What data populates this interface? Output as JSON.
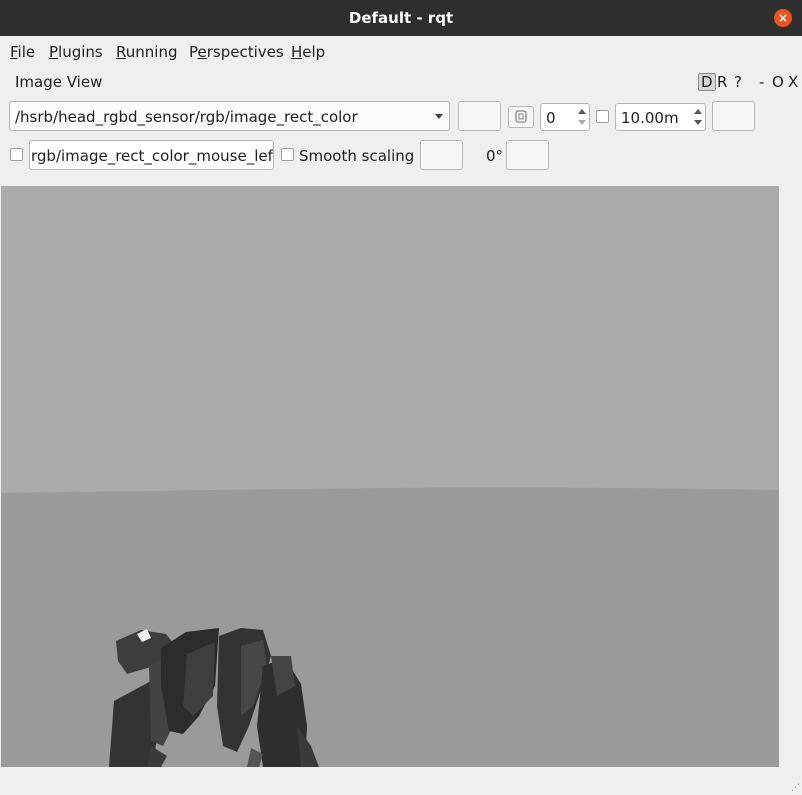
{
  "window": {
    "title": "Default - rqt",
    "close_glyph": "×"
  },
  "menubar": {
    "items": [
      {
        "mnemonic": "F",
        "rest": "ile"
      },
      {
        "mnemonic": "P",
        "rest": "lugins"
      },
      {
        "mnemonic": "R",
        "rest": "unning"
      },
      {
        "pre": "P",
        "mnemonic": "e",
        "rest": "rspectives"
      },
      {
        "mnemonic": "H",
        "rest": "elp"
      }
    ]
  },
  "plugin": {
    "title": "Image View",
    "dock_buttons": [
      "D",
      "R",
      "?",
      "-",
      "O",
      "X"
    ]
  },
  "toolbar": {
    "topic": "/hsrb/head_rgbd_sensor/rgb/image_rect_color",
    "spin_value": "0",
    "max_range": "10.00m",
    "mouse_topic": "rgb/image_rect_color_mouse_left",
    "smooth_label": "Smooth scaling",
    "rotation": "0°"
  },
  "colors": {
    "titlebar": "#2e2e2e",
    "close": "#e95420",
    "sky": "#ababab",
    "floor": "#9a9a9a"
  }
}
